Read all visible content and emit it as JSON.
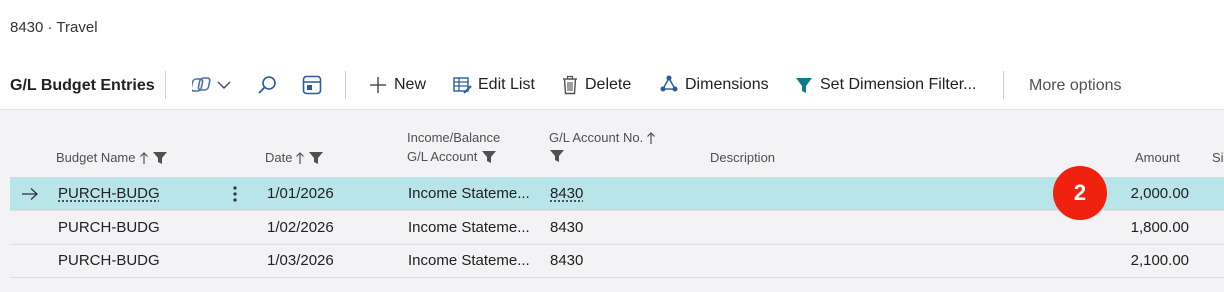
{
  "page": {
    "breadcrumb": "8430 · Travel"
  },
  "actionbar": {
    "title": "G/L Budget Entries",
    "new_label": "New",
    "edit_list_label": "Edit List",
    "delete_label": "Delete",
    "dimensions_label": "Dimensions",
    "set_dimension_filter_label": "Set Dimension Filter...",
    "more_options_label": "More options"
  },
  "table": {
    "headers": {
      "budget_name": "Budget Name",
      "date": "Date",
      "income_balance_line1": "Income/Balance",
      "income_balance_line2": "G/L Account",
      "account_no": "G/L Account No.",
      "description": "Description",
      "amount": "Amount",
      "next_col": "Si"
    },
    "rows": [
      {
        "budget_name": "PURCH-BUDG",
        "date": "1/01/2026",
        "income_balance": "Income Stateme...",
        "account_no": "8430",
        "description": "",
        "amount": "2,000.00"
      },
      {
        "budget_name": "PURCH-BUDG",
        "date": "1/02/2026",
        "income_balance": "Income Stateme...",
        "account_no": "8430",
        "description": "",
        "amount": "1,800.00"
      },
      {
        "budget_name": "PURCH-BUDG",
        "date": "1/03/2026",
        "income_balance": "Income Stateme...",
        "account_no": "8430",
        "description": "",
        "amount": "2,100.00"
      }
    ]
  },
  "annotation": {
    "step_number": "2"
  },
  "colors": {
    "selected_row": "#b9e4ea",
    "badge": "#f0210f",
    "accent": "#0e7c86"
  }
}
